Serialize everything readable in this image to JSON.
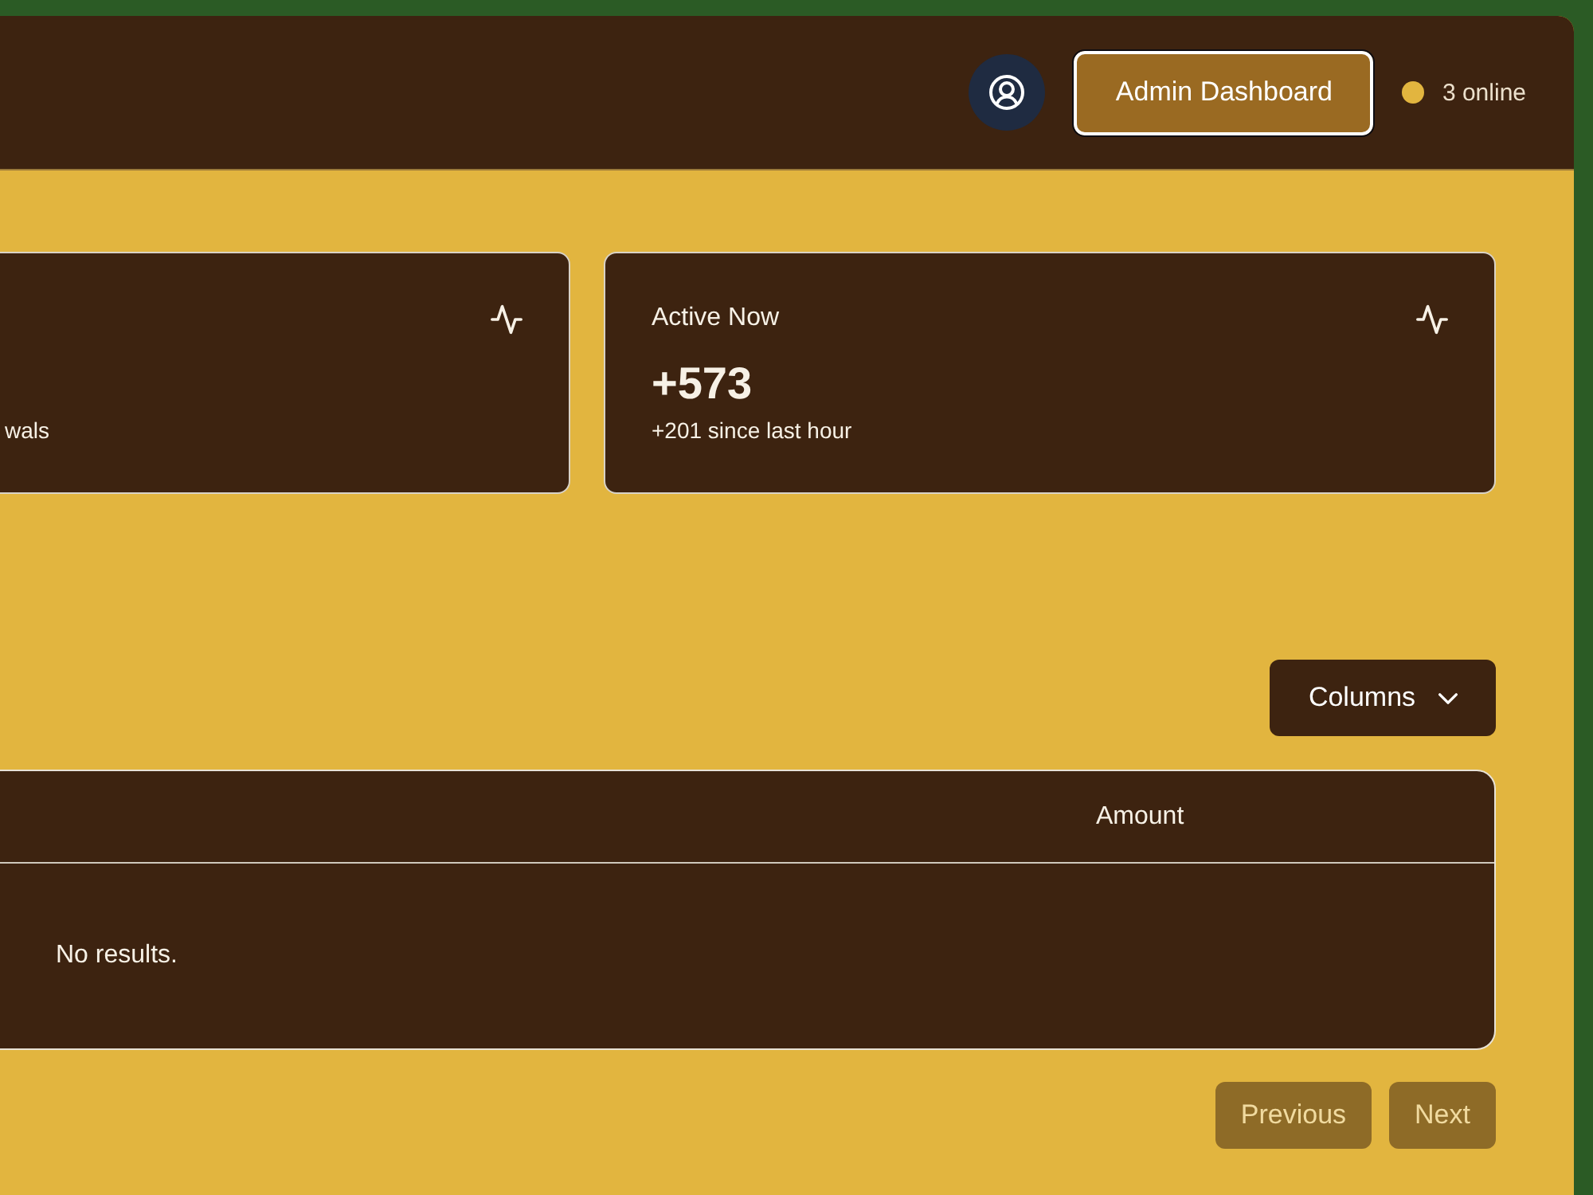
{
  "header": {
    "admin_button": {
      "label": "Admin Dashboard",
      "focused": true
    },
    "status": {
      "text": "3 online"
    }
  },
  "stat_cards": [
    {
      "description": "wals"
    },
    {
      "title": "Active Now",
      "value": "+573",
      "description": "+201 since last hour"
    }
  ],
  "toolbar": {
    "columns_button": {
      "label": "Columns"
    }
  },
  "table": {
    "columns": [
      {
        "label": "Amount"
      }
    ],
    "empty_message": "No results."
  },
  "pagination": [
    {
      "label": "Previous",
      "disabled": true
    },
    {
      "label": "Next",
      "disabled": true
    }
  ]
}
